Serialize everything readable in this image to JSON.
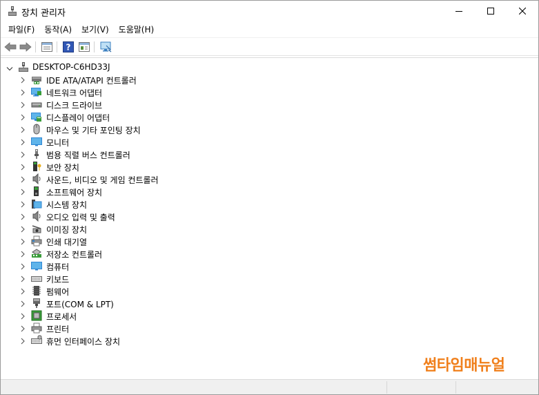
{
  "window": {
    "title": "장치 관리자",
    "controls": {
      "minimize": "minimize-icon",
      "maximize": "maximize-icon",
      "close": "close-icon"
    }
  },
  "menu": {
    "items": [
      {
        "label": "파일(F)"
      },
      {
        "label": "동작(A)"
      },
      {
        "label": "보기(V)"
      },
      {
        "label": "도움말(H)"
      }
    ]
  },
  "toolbar": {
    "buttons": [
      "back-icon",
      "forward-icon",
      "properties-icon",
      "help-icon",
      "show-hidden-icon",
      "scan-hardware-icon"
    ]
  },
  "tree": {
    "root": {
      "label": "DESKTOP-C6HD33J"
    },
    "nodes": [
      {
        "label": "IDE ATA/ATAPI 컨트롤러",
        "icon": "ide-controller-icon"
      },
      {
        "label": "네트워크 어댑터",
        "icon": "network-adapter-icon"
      },
      {
        "label": "디스크 드라이브",
        "icon": "disk-drive-icon"
      },
      {
        "label": "디스플레이 어댑터",
        "icon": "display-adapter-icon"
      },
      {
        "label": "마우스 및 기타 포인팅 장치",
        "icon": "mouse-icon"
      },
      {
        "label": "모니터",
        "icon": "monitor-icon"
      },
      {
        "label": "범용 직렬 버스 컨트롤러",
        "icon": "usb-icon"
      },
      {
        "label": "보안 장치",
        "icon": "security-device-icon"
      },
      {
        "label": "사운드, 비디오 및 게임 컨트롤러",
        "icon": "speaker-icon"
      },
      {
        "label": "소프트웨어 장치",
        "icon": "software-device-icon"
      },
      {
        "label": "시스템 장치",
        "icon": "system-device-icon"
      },
      {
        "label": "오디오 입력 및 출력",
        "icon": "audio-io-icon"
      },
      {
        "label": "이미징 장치",
        "icon": "camera-icon"
      },
      {
        "label": "인쇄 대기열",
        "icon": "print-queue-icon"
      },
      {
        "label": "저장소 컨트롤러",
        "icon": "storage-controller-icon"
      },
      {
        "label": "컴퓨터",
        "icon": "computer-icon"
      },
      {
        "label": "키보드",
        "icon": "keyboard-icon"
      },
      {
        "label": "펌웨어",
        "icon": "firmware-icon"
      },
      {
        "label": "포트(COM & LPT)",
        "icon": "port-icon"
      },
      {
        "label": "프로세서",
        "icon": "processor-icon"
      },
      {
        "label": "프린터",
        "icon": "printer-icon"
      },
      {
        "label": "휴먼 인터페이스 장치",
        "icon": "hid-icon"
      }
    ]
  },
  "watermark": {
    "text": "썸타임매뉴얼",
    "color": "#f07f1b"
  },
  "colors": {
    "icon_blue": "#2f86d3",
    "icon_green": "#3a9d3a"
  }
}
